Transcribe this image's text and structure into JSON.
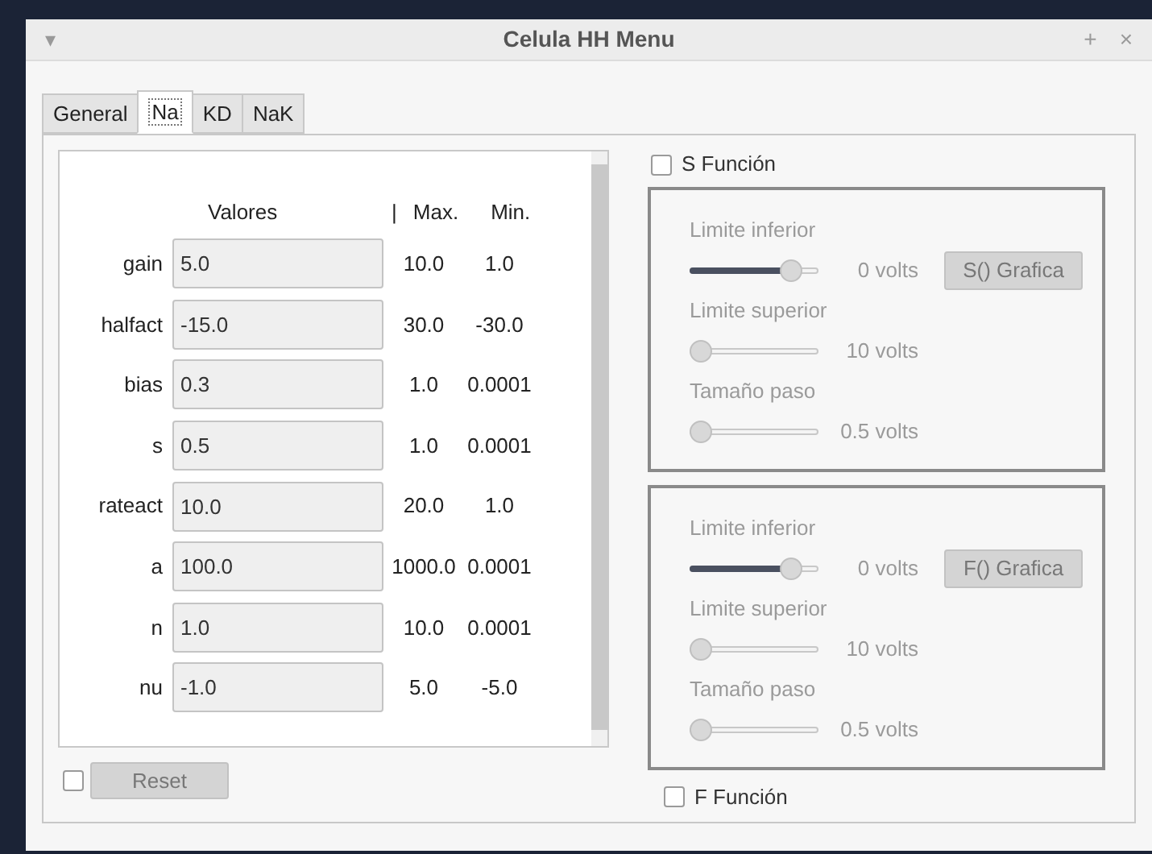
{
  "window": {
    "title": "Celula HH Menu",
    "menu_glyph": "▾",
    "buttons": [
      "+",
      "×"
    ]
  },
  "tabs": [
    {
      "label": "General",
      "selected": false
    },
    {
      "label": "Na",
      "selected": true
    },
    {
      "label": "KD",
      "selected": false
    },
    {
      "label": "NaK",
      "selected": false
    }
  ],
  "params": {
    "headers": [
      "Valores",
      "|",
      "Max.",
      "Min."
    ],
    "rows": [
      {
        "name": "gain",
        "value": "5.0",
        "max": "10.0",
        "min": "1.0"
      },
      {
        "name": "halfact",
        "value": "-15.0",
        "max": "30.0",
        "min": "-30.0"
      },
      {
        "name": "bias",
        "value": "0.3",
        "max": "1.0",
        "min": "0.0001"
      },
      {
        "name": "s",
        "value": "0.5",
        "max": "1.0",
        "min": "0.0001"
      },
      {
        "name": "rateact",
        "value": "10.0",
        "max": "20.0",
        "min": "1.0"
      },
      {
        "name": "a",
        "value": "100.0",
        "max": "1000.0",
        "min": "0.0001"
      },
      {
        "name": "n",
        "value": "1.0",
        "max": "10.0",
        "min": "0.0001"
      },
      {
        "name": "nu",
        "value": "-1.0",
        "max": "5.0",
        "min": "-5.0"
      }
    ]
  },
  "reset": {
    "checked": false,
    "label": "Reset",
    "disabled": true
  },
  "s_function": {
    "label": "S Función",
    "checked": false,
    "button": "S() Grafica",
    "sliders": [
      {
        "label": "Limite inferior",
        "level": 0.85,
        "reading": "0 volts"
      },
      {
        "label": "Limite superior",
        "level": 0,
        "reading": "10 volts"
      },
      {
        "label": "Tamaño paso",
        "level": 0,
        "reading": "0.5 volts"
      }
    ]
  },
  "f_function": {
    "label": "F Función",
    "checked": false,
    "button": "F() Grafica",
    "sliders": [
      {
        "label": "Limite inferior",
        "level": 0.85,
        "reading": "0 volts"
      },
      {
        "label": "Limite superior",
        "level": 0,
        "reading": "10 volts"
      },
      {
        "label": "Tamaño paso",
        "level": 0,
        "reading": "0.5 volts"
      }
    ]
  }
}
